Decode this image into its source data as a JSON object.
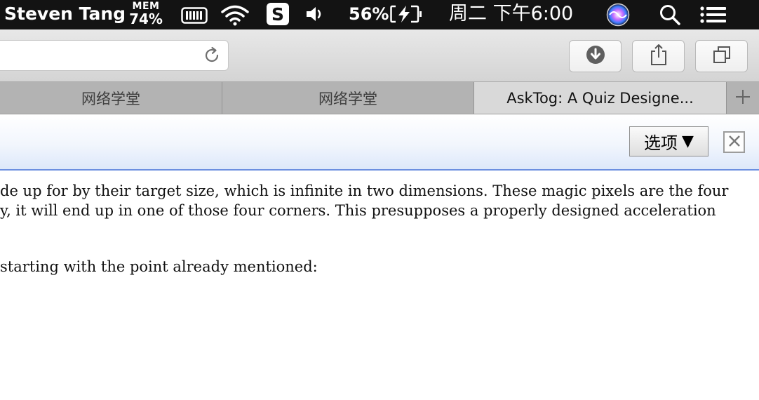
{
  "menubar": {
    "user_name": "Steven Tang",
    "mem_label": "MEM",
    "mem_value": "74%",
    "battery_percent": "56%",
    "clock": "周二 下午6:00",
    "icons": [
      "disk-icon",
      "wifi-icon",
      "sogou-input-icon",
      "volume-icon",
      "battery-charging-icon",
      "siri-icon",
      "spotlight-search-icon",
      "notification-center-icon"
    ]
  },
  "toolbar": {
    "icons": [
      "reload-icon",
      "download-icon",
      "share-icon",
      "tab-overview-icon"
    ]
  },
  "tabs": [
    {
      "label": "网络学堂",
      "active": false
    },
    {
      "label": "网络学堂",
      "active": false
    },
    {
      "label": "AskTog: A Quiz Designe...",
      "active": true
    }
  ],
  "new_tab_icon": "plus-icon",
  "findbar": {
    "options_label": "选项",
    "options_caret": "▼",
    "close_icon": "close-icon"
  },
  "content": {
    "lines": [
      "de up for by their target size, which is infinite in two dimensions. These magic pixels are the four",
      "y, it will end up in one of those four corners. This presupposes a properly designed acceleration",
      "starting with the point already mentioned:"
    ]
  },
  "colors": {
    "menubar_bg": "#131313",
    "toolbar_bg": "#dcdcdc",
    "tabbar_bg": "#b3b3b3",
    "active_tab_bg": "#d9d9d9",
    "findbar_border": "#6c8fe0",
    "sogou_blue": "#3b6fd6"
  }
}
